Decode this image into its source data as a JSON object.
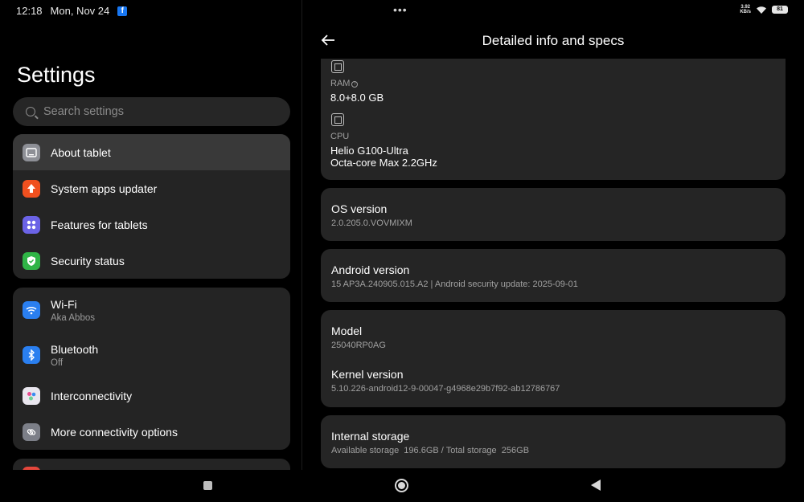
{
  "status_bar": {
    "time": "12:18",
    "date": "Mon, Nov 24",
    "app_icon": "facebook-icon",
    "speed_value": "3.92",
    "speed_unit": "KB/s",
    "battery": "81"
  },
  "left_pane": {
    "title": "Settings",
    "search_placeholder": "Search settings",
    "group1": [
      {
        "label": "About tablet",
        "icon": "tablet-icon",
        "color": "#8d8f96",
        "selected": true
      },
      {
        "label": "System apps updater",
        "icon": "arrow-up-icon",
        "color": "#f0501f"
      },
      {
        "label": "Features for tablets",
        "icon": "grid-icon",
        "color": "#6b63e6"
      },
      {
        "label": "Security status",
        "icon": "shield-check-icon",
        "color": "#2fb446"
      }
    ],
    "group2": [
      {
        "label": "Wi-Fi",
        "sub": "Aka Abbos",
        "icon": "wifi-icon",
        "color": "#2a7ff0"
      },
      {
        "label": "Bluetooth",
        "sub": "Off",
        "icon": "bluetooth-icon",
        "color": "#2a7ff0"
      },
      {
        "label": "Interconnectivity",
        "icon": "interconnect-icon",
        "color": "#e9e6ee"
      },
      {
        "label": "More connectivity options",
        "icon": "link-icon",
        "color": "#7c7f88"
      }
    ]
  },
  "right_pane": {
    "title": "Detailed info and specs",
    "ram_label": "RAM",
    "ram_value": "8.0+8.0 GB",
    "cpu_label": "CPU",
    "cpu_line1": "Helio G100-Ultra",
    "cpu_line2": "Octa-core Max 2.2GHz",
    "os_title": "OS version",
    "os_value": "2.0.205.0.VOVMIXM",
    "android_title": "Android version",
    "android_value": "15 AP3A.240905.015.A2 | Android security update: 2025-09-01",
    "model_title": "Model",
    "model_value": "25040RP0AG",
    "kernel_title": "Kernel version",
    "kernel_value": "5.10.226-android12-9-00047-g4968e29b7f92-ab12786767",
    "storage_title": "Internal storage",
    "storage_value": "Available storage  196.6GB / Total storage  256GB"
  }
}
